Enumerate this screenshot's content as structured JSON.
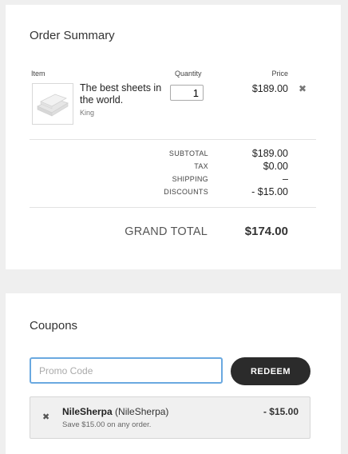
{
  "summary": {
    "title": "Order Summary",
    "columns": {
      "item": "Item",
      "quantity": "Quantity",
      "price": "Price"
    },
    "line_item": {
      "name": "The best sheets in the world.",
      "variant": "King",
      "quantity": "1",
      "price": "$189.00",
      "remove_icon": "close-icon"
    },
    "totals": {
      "subtotal_label": "SUBTOTAL",
      "subtotal_value": "$189.00",
      "tax_label": "TAX",
      "tax_value": "$0.00",
      "shipping_label": "SHIPPING",
      "shipping_value": "–",
      "discounts_label": "DISCOUNTS",
      "discounts_value": "- $15.00"
    },
    "grand_total_label": "GRAND TOTAL",
    "grand_total_value": "$174.00"
  },
  "coupons": {
    "title": "Coupons",
    "promo_placeholder": "Promo Code",
    "promo_value": "",
    "redeem_label": "REDEEM",
    "applied": {
      "code": "NileSherpa",
      "code_paren": "(NileSherpa)",
      "description": "Save $15.00 on any order.",
      "amount": "- $15.00",
      "remove_icon": "close-icon"
    }
  },
  "colors": {
    "page_bg": "#efefef",
    "card_bg": "#ffffff",
    "focus_border": "#6aa9e0",
    "button_bg": "#2b2b2b",
    "coupon_bg": "#f0f0f0"
  }
}
